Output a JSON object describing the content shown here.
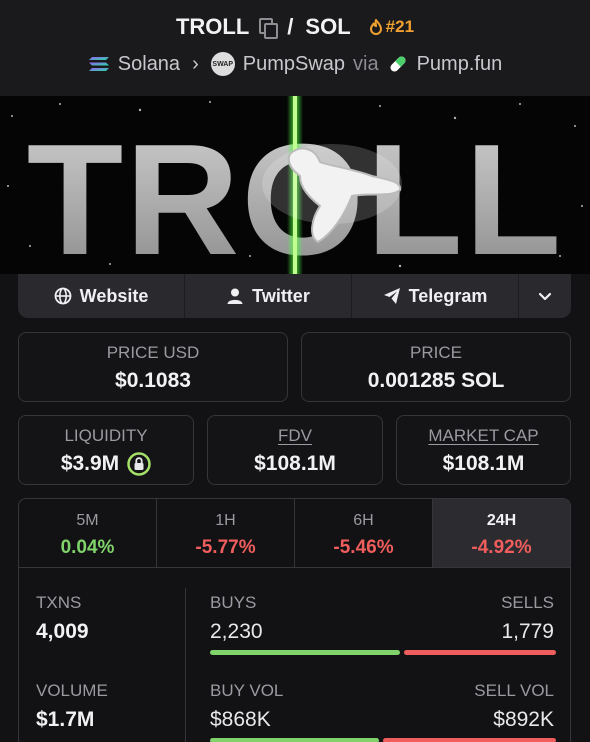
{
  "header": {
    "token": "TROLL",
    "separator": "/",
    "quote": "SOL",
    "rank": "#21",
    "chain": "Solana",
    "dex": "PumpSwap",
    "via": "via",
    "launchpad": "Pump.fun"
  },
  "banner": {
    "text": "TROLL"
  },
  "links": {
    "website": "Website",
    "twitter": "Twitter",
    "telegram": "Telegram"
  },
  "stats": {
    "price_usd_label": "PRICE USD",
    "price_usd": "$0.1083",
    "price_label": "PRICE",
    "price": "0.001285 SOL",
    "liquidity_label": "LIQUIDITY",
    "liquidity": "$3.9M",
    "fdv_label": "FDV",
    "fdv": "$108.1M",
    "mcap_label": "MARKET CAP",
    "mcap": "$108.1M"
  },
  "periods": [
    {
      "label": "5M",
      "value": "0.04%"
    },
    {
      "label": "1H",
      "value": "-5.77%"
    },
    {
      "label": "6H",
      "value": "-5.46%"
    },
    {
      "label": "24H",
      "value": "-4.92%"
    }
  ],
  "txns": {
    "txns_label": "TXNS",
    "txns": "4,009",
    "buys_label": "BUYS",
    "buys": "2,230",
    "sells_label": "SELLS",
    "sells": "1,779",
    "buys_fraction": 0.556,
    "volume_label": "VOLUME",
    "volume": "$1.7M",
    "buy_vol_label": "BUY VOL",
    "buy_vol": "$868K",
    "sell_vol_label": "SELL VOL",
    "sell_vol": "$892K",
    "buy_vol_fraction": 0.493
  },
  "colors": {
    "positive": "#7fd36a",
    "negative": "#ef5d5d",
    "rank": "#f0a030",
    "background": "#121214"
  }
}
